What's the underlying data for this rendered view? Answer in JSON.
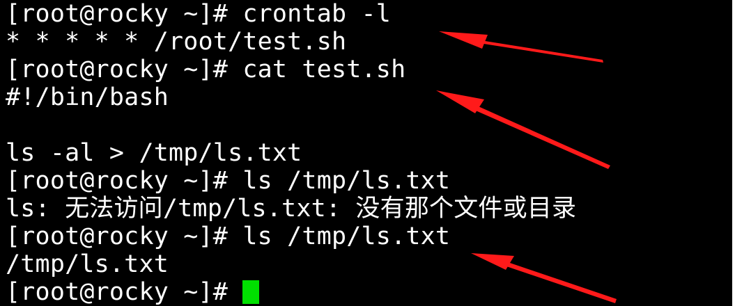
{
  "terminal": {
    "background": "#000000",
    "foreground": "#ffffff",
    "cursor_color": "#00e000",
    "lines": [
      "[root@rocky ~]# crontab -l",
      "* * * * * /root/test.sh",
      "[root@rocky ~]# cat test.sh",
      "#!/bin/bash",
      "",
      "ls -al > /tmp/ls.txt",
      "[root@rocky ~]# ls /tmp/ls.txt",
      "ls: 无法访问/tmp/ls.txt: 没有那个文件或目录",
      "[root@rocky ~]# ls /tmp/ls.txt",
      "/tmp/ls.txt",
      "[root@rocky ~]# "
    ]
  },
  "annotations": {
    "arrow_color": "#ff1a1a",
    "arrows": [
      "arrow-to-crontab-entry",
      "arrow-to-script-content",
      "arrow-to-ls-result"
    ]
  }
}
